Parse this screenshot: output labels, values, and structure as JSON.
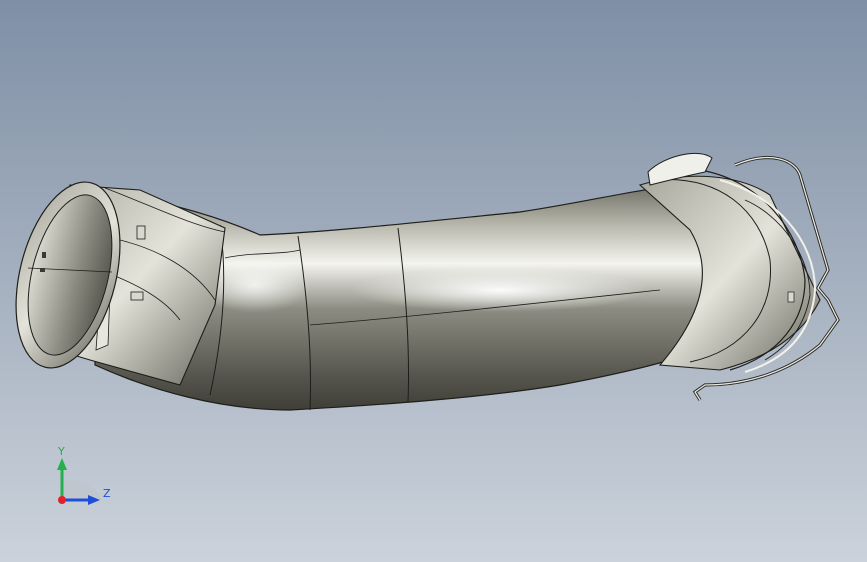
{
  "view": {
    "background_top": "#7f8fa6",
    "background_bottom": "#cbd2db"
  },
  "triad": {
    "y_label": "Y",
    "z_label": "Z",
    "y_color": "#22b14c",
    "z_color": "#1f4fd8",
    "x_color": "#e0202a"
  }
}
